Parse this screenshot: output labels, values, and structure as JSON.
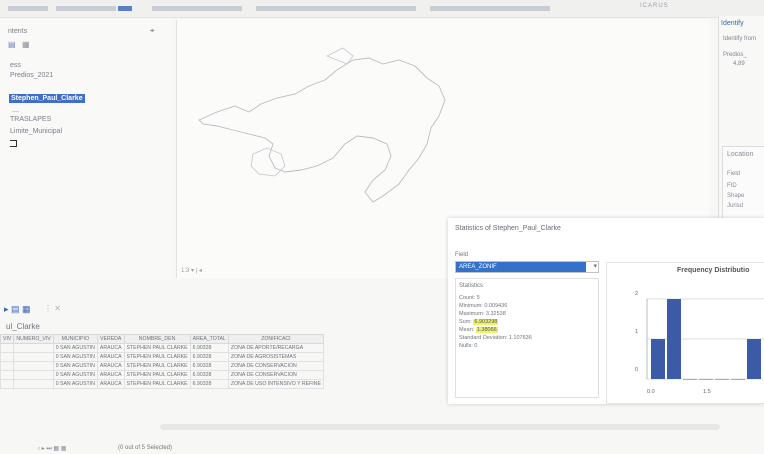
{
  "toolbar": {
    "right_text": "ICARUS"
  },
  "toc": {
    "header": "ntents",
    "items": [
      {
        "label": "ess"
      },
      {
        "label": "Predios_2021"
      },
      {
        "label": "Stephen_Paul_Clarke",
        "selected": true
      },
      {
        "label": "TRASLAPES"
      },
      {
        "label": "Limite_Municipal"
      }
    ]
  },
  "map": {
    "footer": "1:3 ▾ |  ◂"
  },
  "identify": {
    "title": "Identify",
    "identify_from": "Identify from",
    "tree_item": "Predios_",
    "tree_sub": "4,89"
  },
  "location": {
    "header": "Location",
    "rows": [
      "Field",
      "FID",
      "Shape",
      "Jurisd"
    ]
  },
  "attribute_table": {
    "tab_label": "ul_Clarke",
    "columns": [
      "VIV",
      "NUMERO_VIV",
      "MUNICIPIO",
      "VEREDA",
      "NOMBRE_DEN",
      "AREA_TOTAL",
      "ZONIFICACI"
    ],
    "rows": [
      [
        "",
        "",
        "0 SAN AGUSTIN",
        "ARAUCA",
        "STEPHEN PAUL CLARKE",
        "6.90328",
        "ZONA DE APORTE/RECARGA"
      ],
      [
        "",
        "",
        "0 SAN AGUSTIN",
        "ARAUCA",
        "STEPHEN PAUL CLARKE",
        "6.90328",
        "ZONA DE AGROSISTEMAS"
      ],
      [
        "",
        "",
        "0 SAN AGUSTIN",
        "ARAUCA",
        "STEPHEN PAUL CLARKE",
        "6.90328",
        "ZONA DE CONSERVACION"
      ],
      [
        "",
        "",
        "0 SAN AGUSTIN",
        "ARAUCA",
        "STEPHEN PAUL CLARKE",
        "6.90328",
        "ZONA DE CONSERVACION"
      ],
      [
        "",
        "",
        "0 SAN AGUSTIN",
        "ARAUCA",
        "STEPHEN PAUL CLARKE",
        "6.90328",
        "ZONA DE USO INTENSIVO Y REFINE"
      ]
    ]
  },
  "statistics": {
    "title": "Statistics of Stephen_Paul_Clarke",
    "field_label": "Field",
    "field_value": "AREA_ZONIF",
    "stats_header": "Statistics",
    "count": "Count: 5",
    "minimum": "Minimum: 0.009436",
    "maximum": "Maximum: 3.32538",
    "sum_label": "Sum:",
    "sum_value": "6.903298",
    "mean_label": "Mean:",
    "mean_value": "1.38066",
    "std": "Standard Deviation: 1.107636",
    "nulls": "Nulls: 0"
  },
  "chart_data": {
    "type": "bar",
    "title": "Frequency Distributio",
    "y_ticks": [
      "2",
      "1",
      "0"
    ],
    "x_ticks": [
      "0.0",
      "1.5"
    ],
    "ylim": [
      0,
      2
    ],
    "values": [
      1,
      2,
      0,
      0,
      0,
      0,
      1
    ],
    "bar_color": "#3b5aa8"
  },
  "status": {
    "selection": "(0 out of 5 Selected)"
  }
}
